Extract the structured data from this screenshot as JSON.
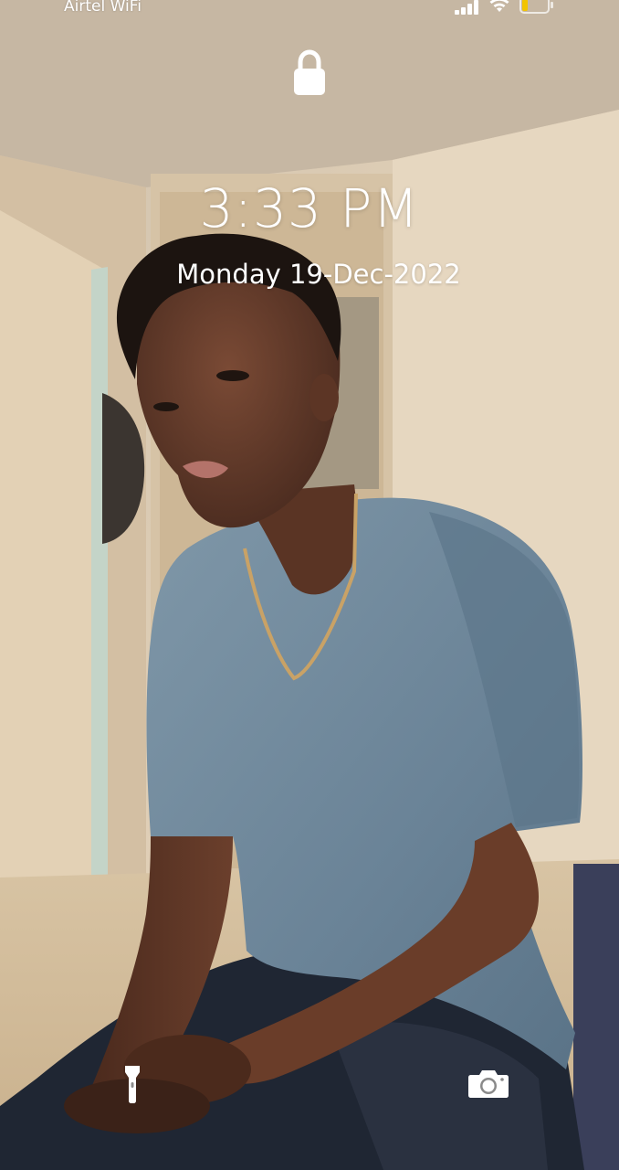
{
  "status_bar": {
    "carrier": "Airtel WiFi",
    "signal_icon": "signal-bars-icon",
    "wifi_icon": "wifi-icon",
    "battery_icon": "battery-low-icon",
    "battery_color": "#f2c400"
  },
  "lock_screen": {
    "lock_icon": "lock-icon",
    "time": "3:33 PM",
    "date": "Monday 19-Dec-2022",
    "flashlight_icon": "flashlight-icon",
    "camera_icon": "camera-icon"
  },
  "wallpaper": {
    "description_icon": "photo-wallpaper",
    "colors": {
      "wall": "#d9c9b1",
      "shirt": "#6b8497",
      "skin": "#5a3526",
      "pants": "#1d2430"
    }
  }
}
